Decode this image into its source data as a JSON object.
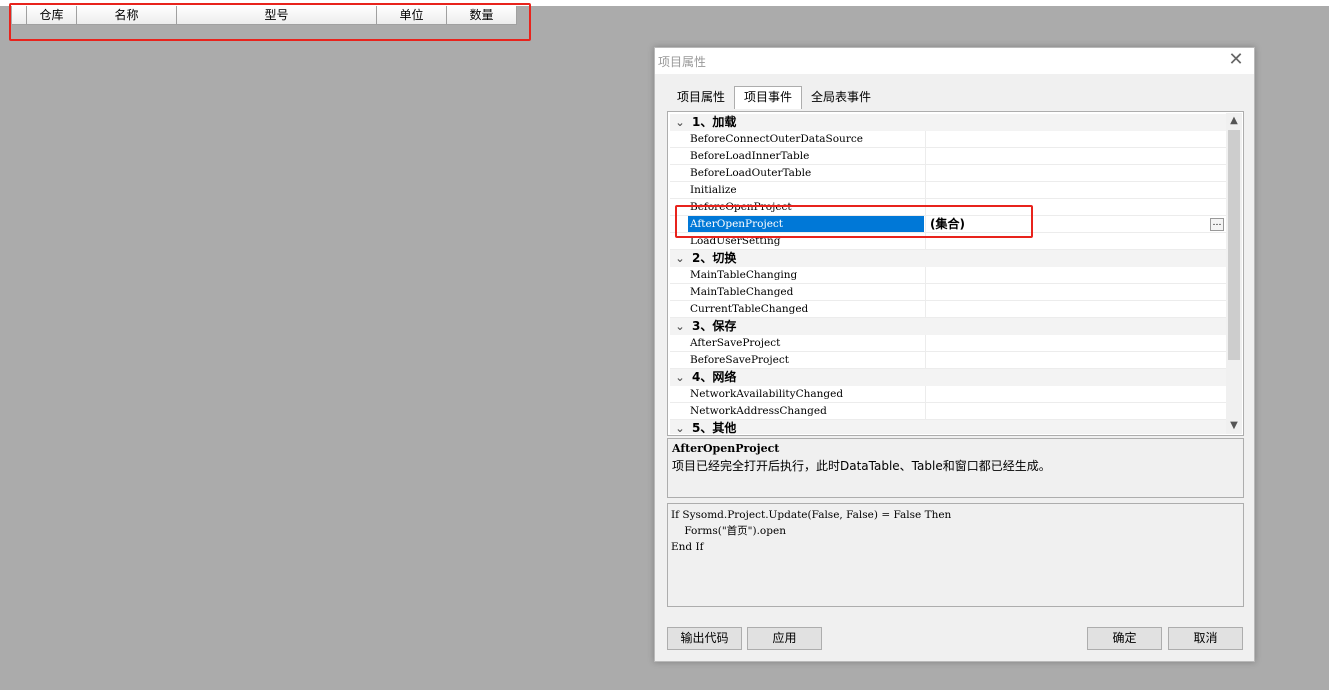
{
  "grid": {
    "columns": [
      "仓库",
      "名称",
      "型号",
      "单位",
      "数量"
    ]
  },
  "dialog": {
    "title": "项目属性",
    "tabs": [
      "项目属性",
      "项目事件",
      "全局表事件"
    ],
    "categories": [
      {
        "label": "1、加载",
        "items": [
          "BeforeConnectOuterDataSource",
          "BeforeLoadInnerTable",
          "BeforeLoadOuterTable",
          "Initialize",
          "BeforeOpenProject",
          "AfterOpenProject",
          "LoadUserSetting"
        ]
      },
      {
        "label": "2、切换",
        "items": [
          "MainTableChanging",
          "MainTableChanged",
          "CurrentTableChanged"
        ]
      },
      {
        "label": "3、保存",
        "items": [
          "AfterSaveProject",
          "BeforeSaveProject"
        ]
      },
      {
        "label": "4、网络",
        "items": [
          "NetworkAvailabilityChanged",
          "NetworkAddressChanged"
        ]
      },
      {
        "label": "5、其他",
        "items": []
      }
    ],
    "selected": {
      "name": "AfterOpenProject",
      "value": "(集合)"
    },
    "description": {
      "title": "AfterOpenProject",
      "text": "项目已经完全打开后执行，此时DataTable、Table和窗口都已经生成。"
    },
    "code": [
      "If Sysomd.Project.Update(False, False) = False Then",
      "    Forms(\"首页\").open",
      "End If"
    ],
    "buttons": {
      "export": "输出代码",
      "apply": "应用",
      "ok": "确定",
      "cancel": "取消"
    }
  },
  "colors": {
    "selection": "#0078d7",
    "highlight_box": "#e8231c",
    "workspace": "#ababab"
  }
}
